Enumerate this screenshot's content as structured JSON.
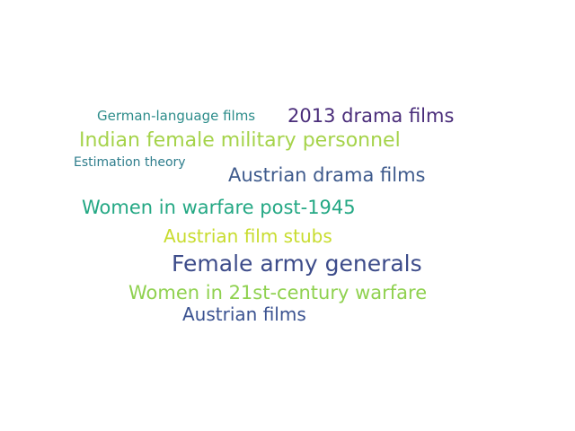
{
  "words": [
    {
      "text": "German-language films",
      "color": "#2c8c8a"
    },
    {
      "text": "2013 drama films",
      "color": "#4a2d7a"
    },
    {
      "text": "Indian female military personnel",
      "color": "#a5d34a"
    },
    {
      "text": "Estimation theory",
      "color": "#2e7d8c"
    },
    {
      "text": "Austrian drama films",
      "color": "#3e5a8c"
    },
    {
      "text": "Women in warfare post-1945",
      "color": "#24a884"
    },
    {
      "text": "Austrian film stubs",
      "color": "#c8dc2e"
    },
    {
      "text": "Female army generals",
      "color": "#3d4c8a"
    },
    {
      "text": "Women in 21st-century warfare",
      "color": "#8fd14f"
    },
    {
      "text": "Austrian films",
      "color": "#3b5391"
    }
  ]
}
